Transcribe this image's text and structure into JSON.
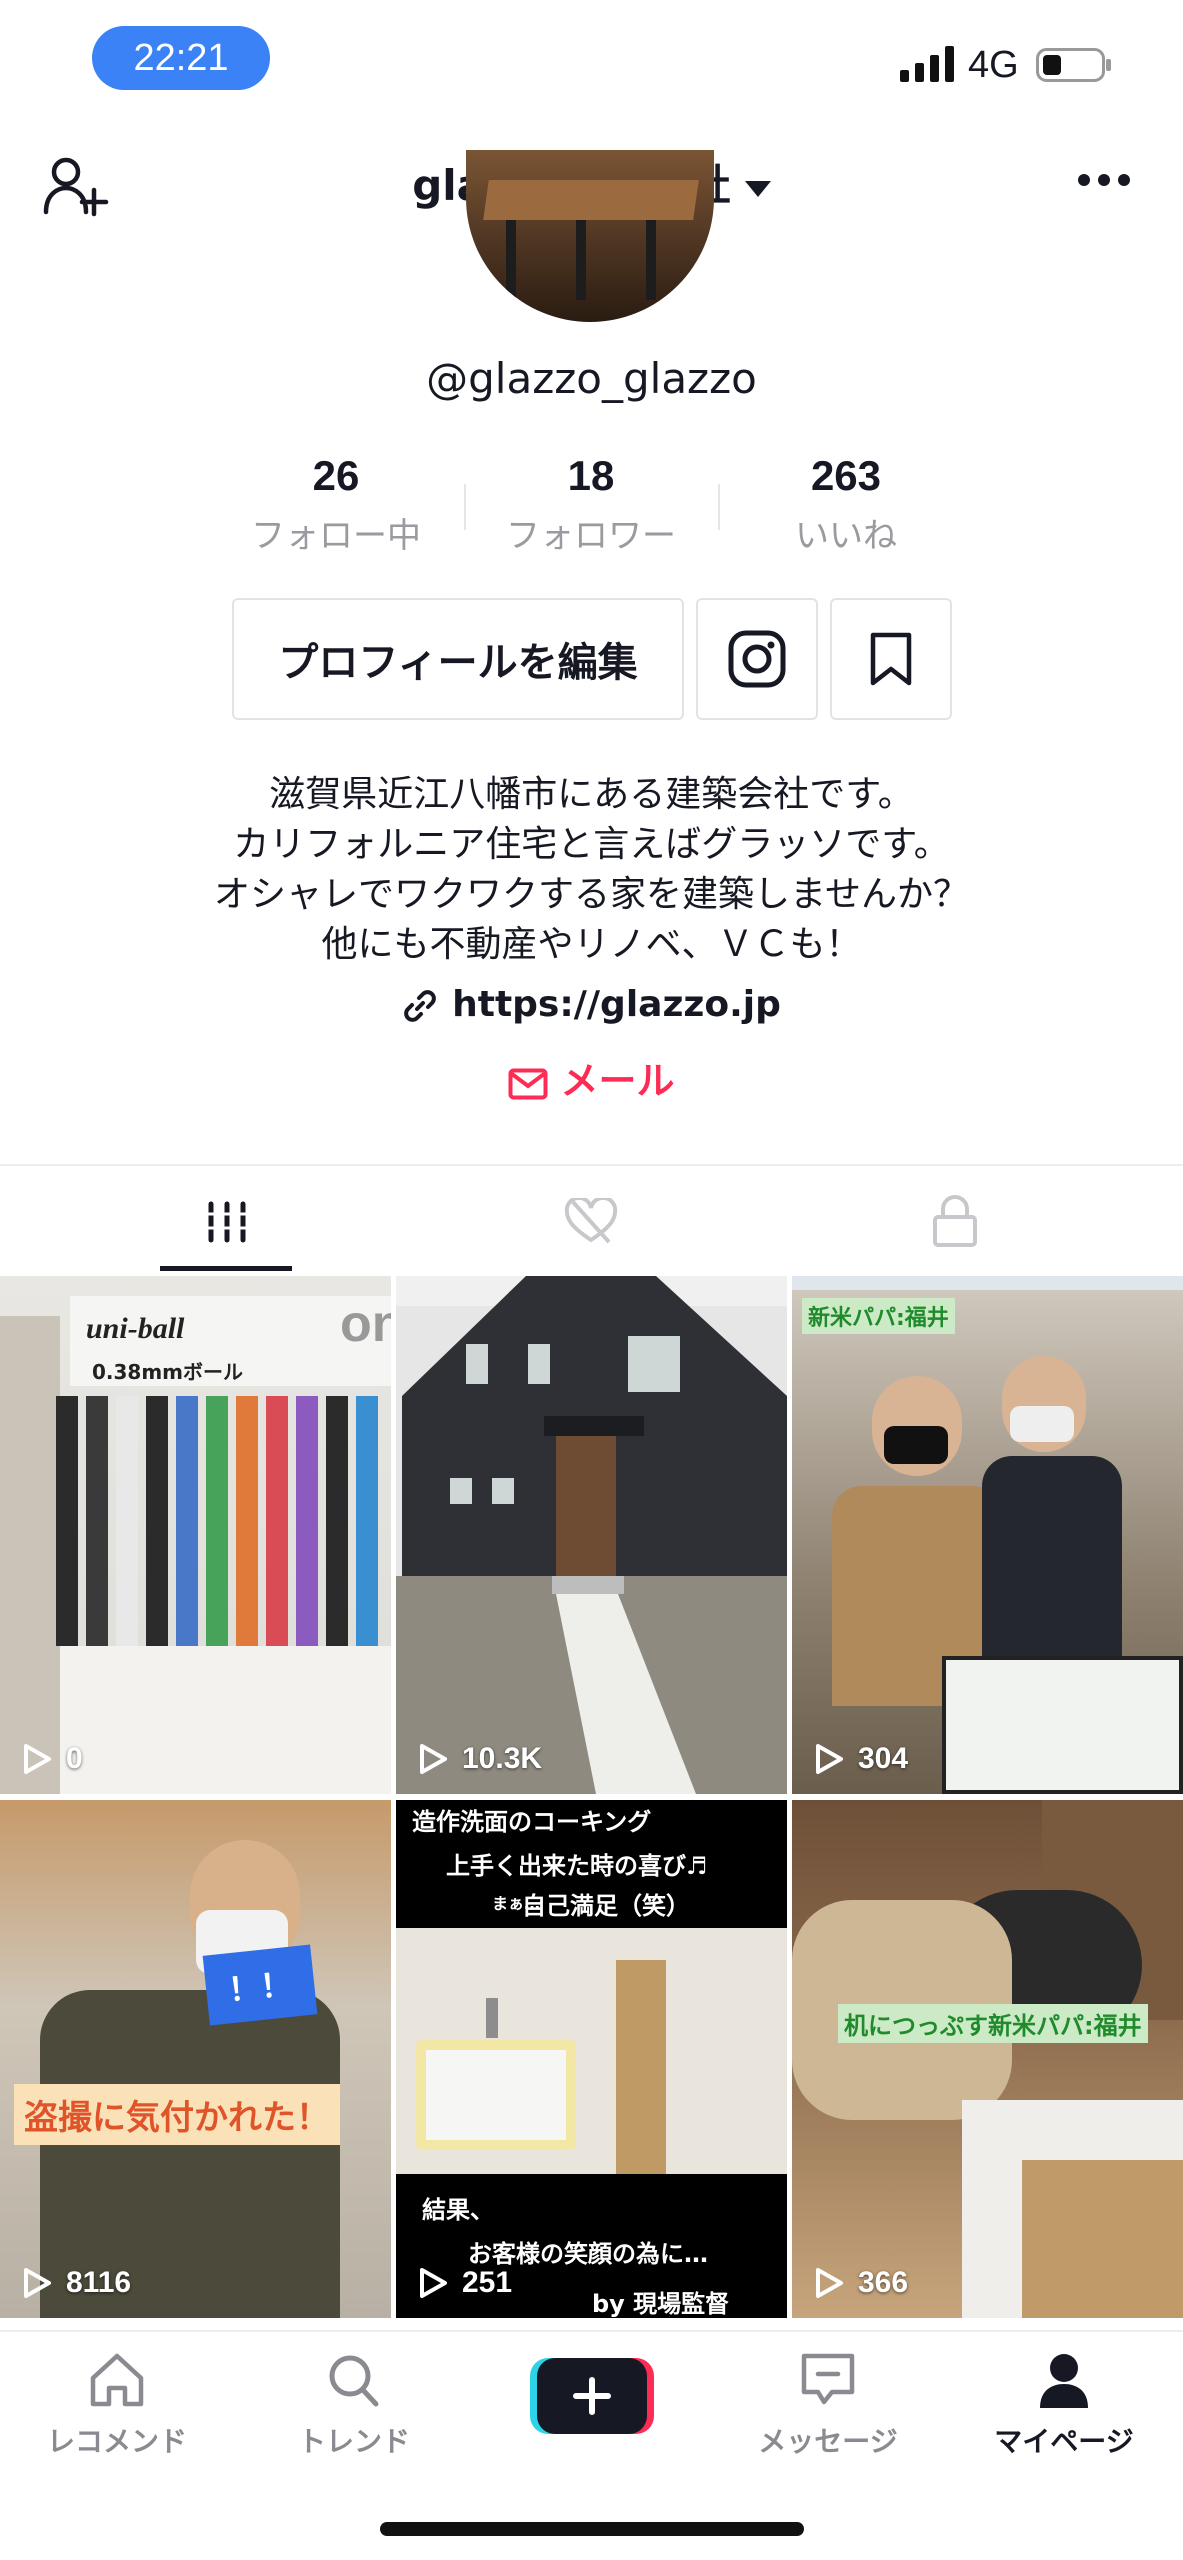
{
  "status_bar": {
    "time": "22:21",
    "network": "4G"
  },
  "header": {
    "account_name": "glazzo株式会社"
  },
  "profile": {
    "handle": "@glazzo_glazzo",
    "stats": [
      {
        "value": "26",
        "label": "フォロー中"
      },
      {
        "value": "18",
        "label": "フォロワー"
      },
      {
        "value": "263",
        "label": "いいね"
      }
    ],
    "edit_button": "プロフィールを編集",
    "bio": [
      "滋賀県近江八幡市にある建築会社です。",
      "カリフォルニア住宅と言えばグラッソです。",
      "オシャレでワクワクする家を建築しませんか？",
      "他にも不動産やリノベ、ＶＣも！"
    ],
    "link": "https://glazzo.jp",
    "mail": "メール"
  },
  "videos": [
    {
      "views": "0",
      "texts": [
        "uni-ball",
        "on",
        "0.38mmボール"
      ]
    },
    {
      "views": "10.3K",
      "texts": []
    },
    {
      "views": "304",
      "texts": [
        "新米パパ:福井"
      ]
    },
    {
      "views": "8116",
      "texts": [
        "盗撮に気付かれた！",
        "！！"
      ]
    },
    {
      "views": "251",
      "texts": [
        "造作洗面のコーキング",
        "上手く出来た時の喜び♬",
        "まぁ…",
        "自己満足（笑）",
        "結果、",
        "お客様の笑顔の為に…",
        "by 現場監督"
      ]
    },
    {
      "views": "366",
      "texts": [
        "机につっぷす新米パパ:福井"
      ]
    }
  ],
  "bottom_nav": [
    {
      "label": "レコメンド",
      "icon": "home-icon"
    },
    {
      "label": "トレンド",
      "icon": "search-icon"
    },
    {
      "label": "",
      "icon": "plus-icon"
    },
    {
      "label": "メッセージ",
      "icon": "message-icon"
    },
    {
      "label": "マイページ",
      "icon": "profile-icon"
    }
  ],
  "colors": {
    "accent": "#fe2c55",
    "time_pill": "#3b82f6",
    "text": "#161823",
    "muted": "#9a9aa0"
  }
}
